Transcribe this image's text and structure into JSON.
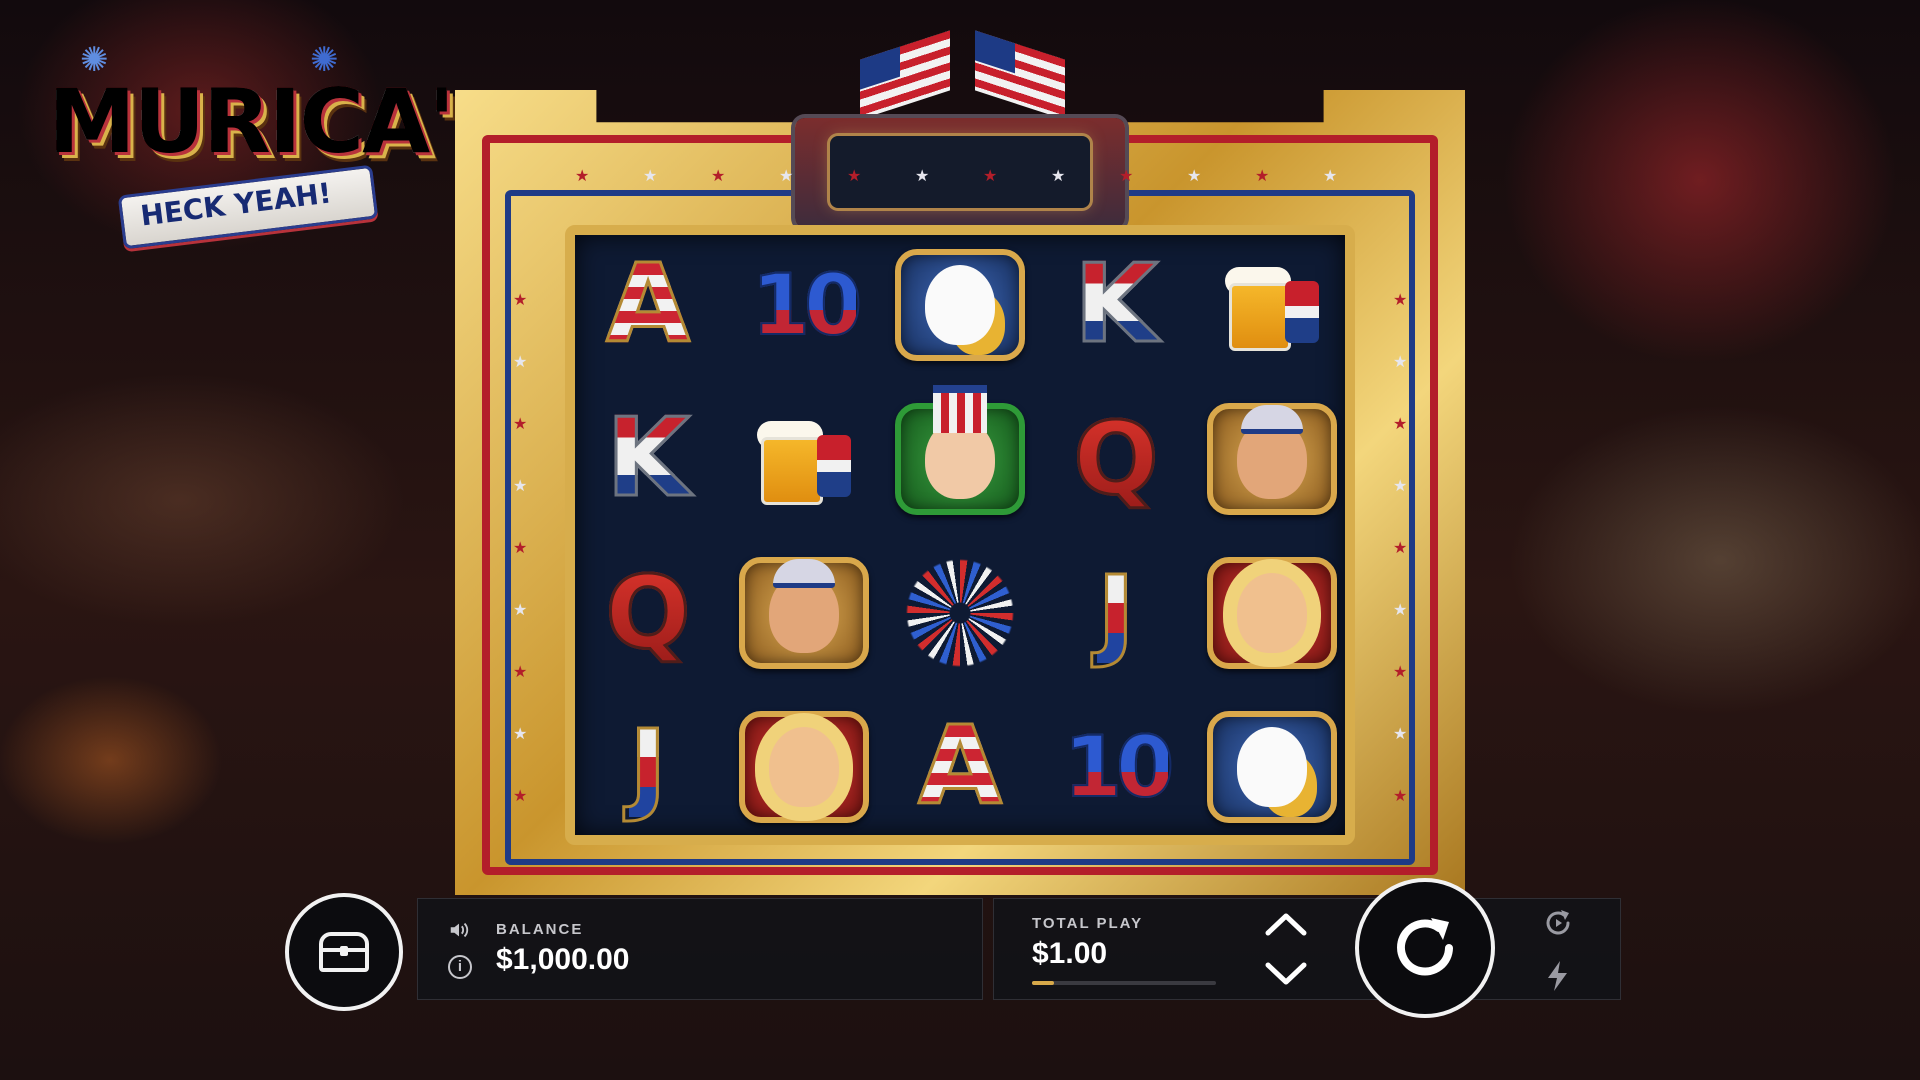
{
  "game": {
    "logo_title": "MURICA'",
    "logo_subtitle": "HECK YEAH!"
  },
  "reels": [
    [
      {
        "symbol": "A",
        "kind": "letter"
      },
      {
        "symbol": "10",
        "kind": "ten"
      },
      {
        "symbol": "eagle",
        "kind": "card"
      },
      {
        "symbol": "K",
        "kind": "letter"
      },
      {
        "symbol": "beer",
        "kind": "beer"
      }
    ],
    [
      {
        "symbol": "K",
        "kind": "letter"
      },
      {
        "symbol": "beer",
        "kind": "beer"
      },
      {
        "symbol": "uncle-sam",
        "kind": "card"
      },
      {
        "symbol": "Q",
        "kind": "letter"
      },
      {
        "symbol": "redneck",
        "kind": "card"
      }
    ],
    [
      {
        "symbol": "Q",
        "kind": "letter"
      },
      {
        "symbol": "redneck",
        "kind": "card"
      },
      {
        "symbol": "fireworks",
        "kind": "firework"
      },
      {
        "symbol": "J",
        "kind": "letter"
      },
      {
        "symbol": "blonde",
        "kind": "card"
      }
    ],
    [
      {
        "symbol": "J",
        "kind": "letter"
      },
      {
        "symbol": "blonde",
        "kind": "card"
      },
      {
        "symbol": "A",
        "kind": "letter"
      },
      {
        "symbol": "10",
        "kind": "ten"
      },
      {
        "symbol": "eagle",
        "kind": "card"
      }
    ]
  ],
  "controls": {
    "balance_label": "BALANCE",
    "balance_value": "$1,000.00",
    "total_play_label": "TOTAL PLAY",
    "total_play_value": "$1.00",
    "bet_level_fraction": 0.12,
    "icons": {
      "chest": "treasure-chest-icon",
      "sound": "speaker-icon",
      "info": "info-icon",
      "increase": "chevron-up-icon",
      "decrease": "chevron-down-icon",
      "spin": "spin-arrow-icon",
      "autoplay": "autoplay-icon",
      "turbo": "lightning-icon"
    }
  },
  "colors": {
    "frame_gold": "#d7ad4c",
    "grid_bg": "#0e1a33",
    "accent_red": "#b31e2a",
    "accent_blue": "#1f3b86"
  }
}
